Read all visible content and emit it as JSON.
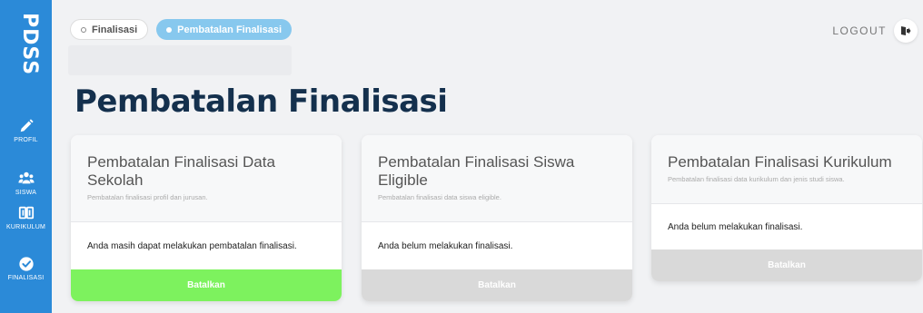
{
  "sidebar": {
    "brand": "PDSS",
    "items": [
      {
        "label": "PROFIL",
        "icon": "pencil-icon"
      },
      {
        "label": "SISWA",
        "icon": "users-icon"
      },
      {
        "label": "KURIKULUM",
        "icon": "book-icon"
      },
      {
        "label": "FINALISASI",
        "icon": "check-circle-icon"
      }
    ],
    "color": "#2b8ad8"
  },
  "tabs": [
    {
      "label": "Finalisasi",
      "active": false
    },
    {
      "label": "Pembatalan Finalisasi",
      "active": true
    }
  ],
  "header": {
    "logout_label": "LOGOUT"
  },
  "page": {
    "title": "Pembatalan Finalisasi"
  },
  "cards": [
    {
      "title": "Pembatalan Finalisasi Data Sekolah",
      "subtitle": "Pembatalan finalisasi profil dan jurusan.",
      "status": "Anda masih dapat melakukan pembatalan finalisasi.",
      "button": "Batalkan",
      "button_enabled": true
    },
    {
      "title": "Pembatalan Finalisasi Siswa Eligible",
      "subtitle": "Pembatalan finalisasi data siswa eligible.",
      "status": "Anda belum melakukan finalisasi.",
      "button": "Batalkan",
      "button_enabled": false
    },
    {
      "title": "Pembatalan Finalisasi Kurikulum",
      "subtitle": "Pembatalan finalisasi data kurikulum dan jenis studi siswa.",
      "status": "Anda belum melakukan finalisasi.",
      "button": "Batalkan",
      "button_enabled": false
    }
  ],
  "colors": {
    "accent": "#2b8ad8",
    "active_tab": "#87c8ee",
    "enabled_button": "#7df25e",
    "disabled_button": "#d9d9d9",
    "title": "#14304d"
  }
}
